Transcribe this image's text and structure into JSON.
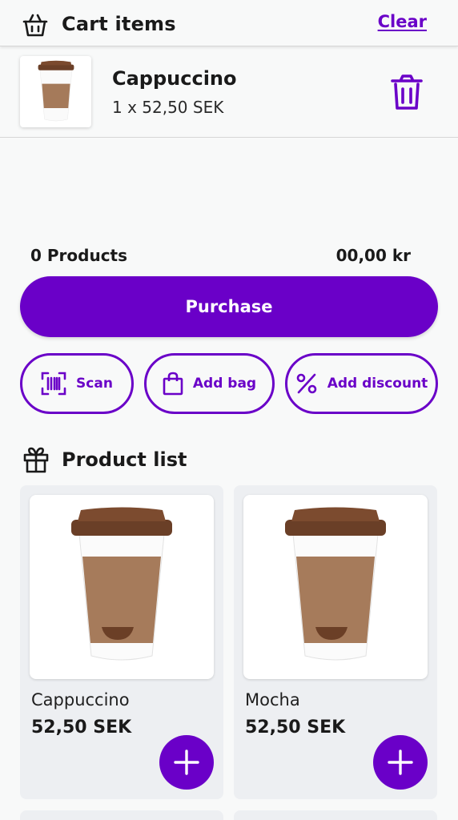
{
  "header": {
    "title": "Cart items",
    "clear_label": "Clear",
    "icon": "basket-icon"
  },
  "cart": {
    "items": [
      {
        "name": "Cappuccino",
        "quantity_line": "1 x 52,50 SEK",
        "icon": "trash-icon"
      }
    ]
  },
  "summary": {
    "count_label": "0 Products",
    "total": "00,00 kr"
  },
  "actions": {
    "purchase_label": "Purchase",
    "scan_label": "Scan",
    "bag_label": "Add bag",
    "discount_label": "Add discount"
  },
  "product_list": {
    "title": "Product list",
    "icon": "gift-icon",
    "products": [
      {
        "name": "Cappuccino",
        "price": "52,50 SEK"
      },
      {
        "name": "Mocha",
        "price": "52,50 SEK"
      }
    ]
  },
  "colors": {
    "accent": "#6a00c8",
    "background": "#f8f9f9",
    "card": "#edeff2"
  }
}
